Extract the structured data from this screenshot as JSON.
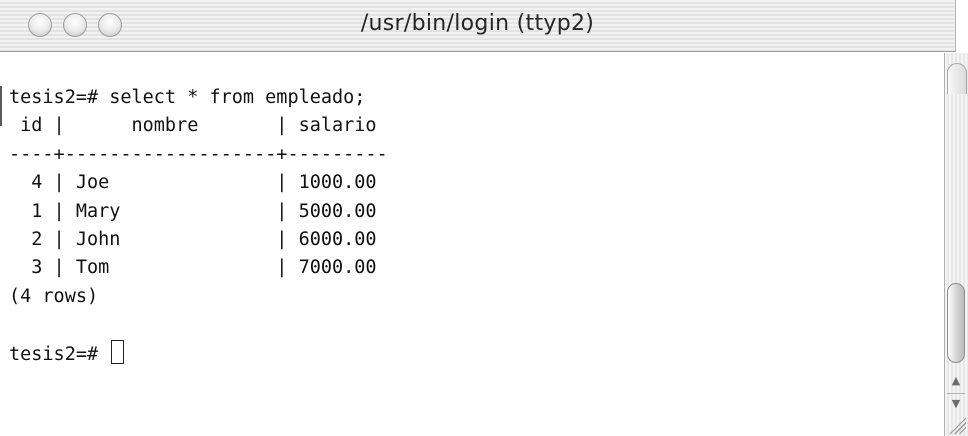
{
  "window": {
    "title": "/usr/bin/login  (ttyp2)",
    "buttons": [
      "close",
      "minimize",
      "zoom"
    ]
  },
  "terminal": {
    "lines": [
      "tesis2=# select * from empleado;",
      " id |      nombre       | salario",
      "----+-------------------+---------",
      "  4 | Joe               | 1000.00",
      "  1 | Mary              | 5000.00",
      "  2 | John              | 6000.00",
      "  3 | Tom               | 7000.00",
      "(4 rows)",
      "",
      "tesis2=# "
    ],
    "prompt": "tesis2=# ",
    "query": {
      "command": "select * from empleado;",
      "columns": [
        "id",
        "nombre",
        "salario"
      ],
      "rows": [
        [
          "4",
          "Joe",
          "1000.00"
        ],
        [
          "1",
          "Mary",
          "5000.00"
        ],
        [
          "2",
          "John",
          "6000.00"
        ],
        [
          "3",
          "Tom",
          "7000.00"
        ]
      ],
      "row_count": "(4 rows)"
    }
  },
  "scrollbar": {
    "up_arrow": "▲",
    "down_arrow": "▼"
  }
}
